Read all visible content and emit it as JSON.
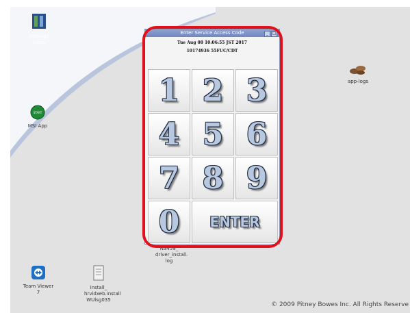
{
  "desktop": {
    "icons": [
      {
        "label": "Settings Icons",
        "icon": "settings-icon"
      },
      {
        "label": "MSI App",
        "icon": "msi-app-icon",
        "badge": "START"
      },
      {
        "label": "app-logs",
        "icon": "app-logs-icon"
      },
      {
        "label": "NS459_ driver_install. log",
        "icon": "log-file-icon"
      },
      {
        "label": "Team Viewer 7",
        "icon": "teamviewer-icon"
      },
      {
        "label": "install_ hrvidxeb.install WUlsg035",
        "icon": "install-log-icon"
      }
    ],
    "copyright": "© 2009 Pitney Bowes Inc. All Rights Reserve"
  },
  "dialog": {
    "title": "Enter Service Access Code",
    "datetime": "Tue Aug 08 10:06:55 JST 2017",
    "id_line": "10174936 55FUC/CDT",
    "keys": [
      "1",
      "2",
      "3",
      "4",
      "5",
      "6",
      "7",
      "8",
      "9",
      "0"
    ],
    "enter_label": "ENTER"
  },
  "colors": {
    "highlight": "#e0101c",
    "title_bar": "#7b8fc6",
    "desktop_bg": "#e2e2e2"
  }
}
